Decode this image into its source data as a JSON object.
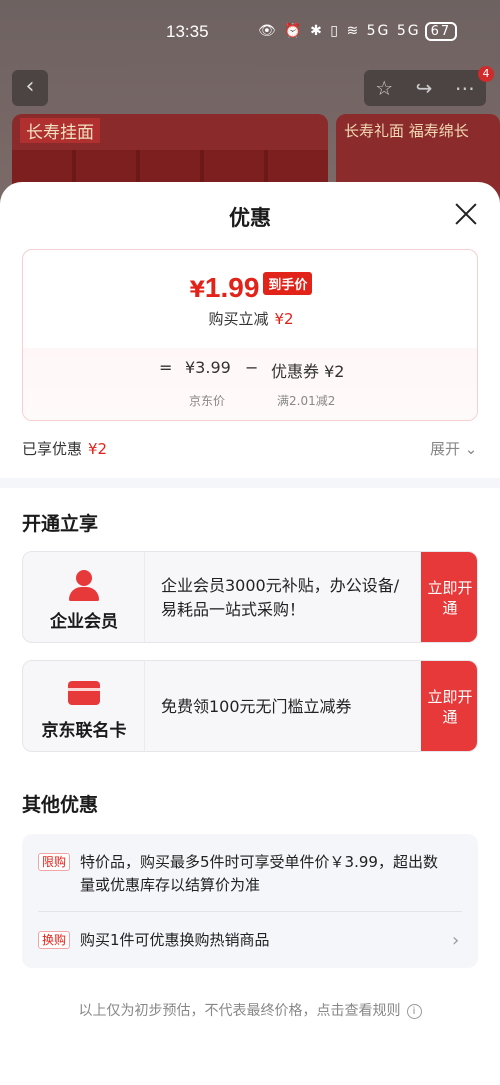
{
  "status_bar": {
    "time": "13:35",
    "icons": "👁 ⏰ ✱ ▯ ≋ 5G 5G",
    "battery": "67"
  },
  "background": {
    "promo_left_tag": "长寿挂面",
    "promo_right_tag": "长寿礼面 福寿绵长",
    "notification_count": "4"
  },
  "sheet": {
    "title": "优惠",
    "price": {
      "currency": "¥",
      "final_price": "1.99",
      "final_badge": "到手价",
      "reduce_label": "购买立减",
      "reduce_value": "¥2",
      "equals": "=",
      "jd_price": "¥3.99",
      "minus": "−",
      "coupon": "优惠券 ¥2",
      "jd_price_label": "京东价",
      "coupon_label": "满2.01减2"
    },
    "enjoyed_label": "已享优惠",
    "enjoyed_value": "¥2",
    "expand_label": "展开",
    "open_section_title": "开通立享",
    "memberships": [
      {
        "name": "企业会员",
        "icon": "person-icon",
        "desc": "企业会员3000元补贴，办公设备/易耗品一站式采购！",
        "cta": "立即开通"
      },
      {
        "name": "京东联名卡",
        "icon": "credit-card-icon",
        "desc": "免费领100元无门槛立减券",
        "cta": "立即开通"
      }
    ],
    "other_section_title": "其他优惠",
    "other_offers": [
      {
        "tag": "限购",
        "text": "特价品，购买最多5件时可享受单件价￥3.99，超出数量或优惠库存以结算价为准"
      },
      {
        "tag": "换购",
        "text": "购买1件可优惠换购热销商品"
      }
    ],
    "footer_note": "以上仅为初步预估，不代表最终价格，点击查看规则"
  },
  "colors": {
    "accent": "#e2231a",
    "cta": "#e8393a"
  }
}
